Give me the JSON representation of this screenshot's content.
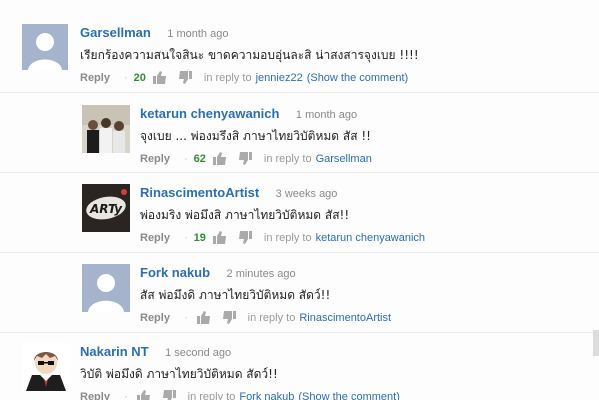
{
  "comments": [
    {
      "name": "Garsellman",
      "time": "1 month ago",
      "text": "เรียกร้องความสนใจสินะ ขาดความอบอุ่นละสิ น่าสงสารจุงเบย !!!!",
      "reply_label": "Reply",
      "likes": "20",
      "in_reply_to_label": "in reply to",
      "reply_target": "jenniez22",
      "show_comment_label": "(Show the comment)",
      "avatar": "default-silhouette-avatar"
    },
    {
      "name": "ketarun chenyawanich",
      "time": "1 month ago",
      "text": "จุงเบย ... พ่องมรึงสิ ภาษาไทยวิบัติหมด สัส !!",
      "reply_label": "Reply",
      "likes": "62",
      "in_reply_to_label": "in reply to",
      "reply_target": "Garsellman",
      "avatar": "group-photo-avatar"
    },
    {
      "name": "RinascimentoArtist",
      "time": "3 weeks ago",
      "text": "พ่องมริง พ่อมึงสิ ภาษาไทยวิบัติหมด สัส!!",
      "reply_label": "Reply",
      "likes": "19",
      "in_reply_to_label": "in reply to",
      "reply_target": "ketarun chenyawanich",
      "avatar": "arty-logo-avatar",
      "avatar_text": "ARTy"
    },
    {
      "name": "Fork nakub",
      "time": "2 minutes ago",
      "text": "สัส พ่อมึงดิ ภาษาไทยวิบัติหมด สัดว์!!",
      "reply_label": "Reply",
      "in_reply_to_label": "in reply to",
      "reply_target": "RinascimentoArtist",
      "avatar": "default-silhouette-avatar"
    },
    {
      "name": "Nakarin NT",
      "time": "1 second ago",
      "text": "วิบัติ พ่อมึงดิ ภาษาไทยวิบัติหมด สัดว์!!",
      "reply_label": "Reply",
      "in_reply_to_label": "in reply to",
      "reply_target": "Fork nakub",
      "show_comment_label": "(Show the comment)",
      "avatar": "cartoon-suit-avatar"
    }
  ],
  "colors": {
    "link": "#2a6fb4",
    "likes": "#2f8f2f",
    "default_avatar": "#a6b3cc"
  }
}
